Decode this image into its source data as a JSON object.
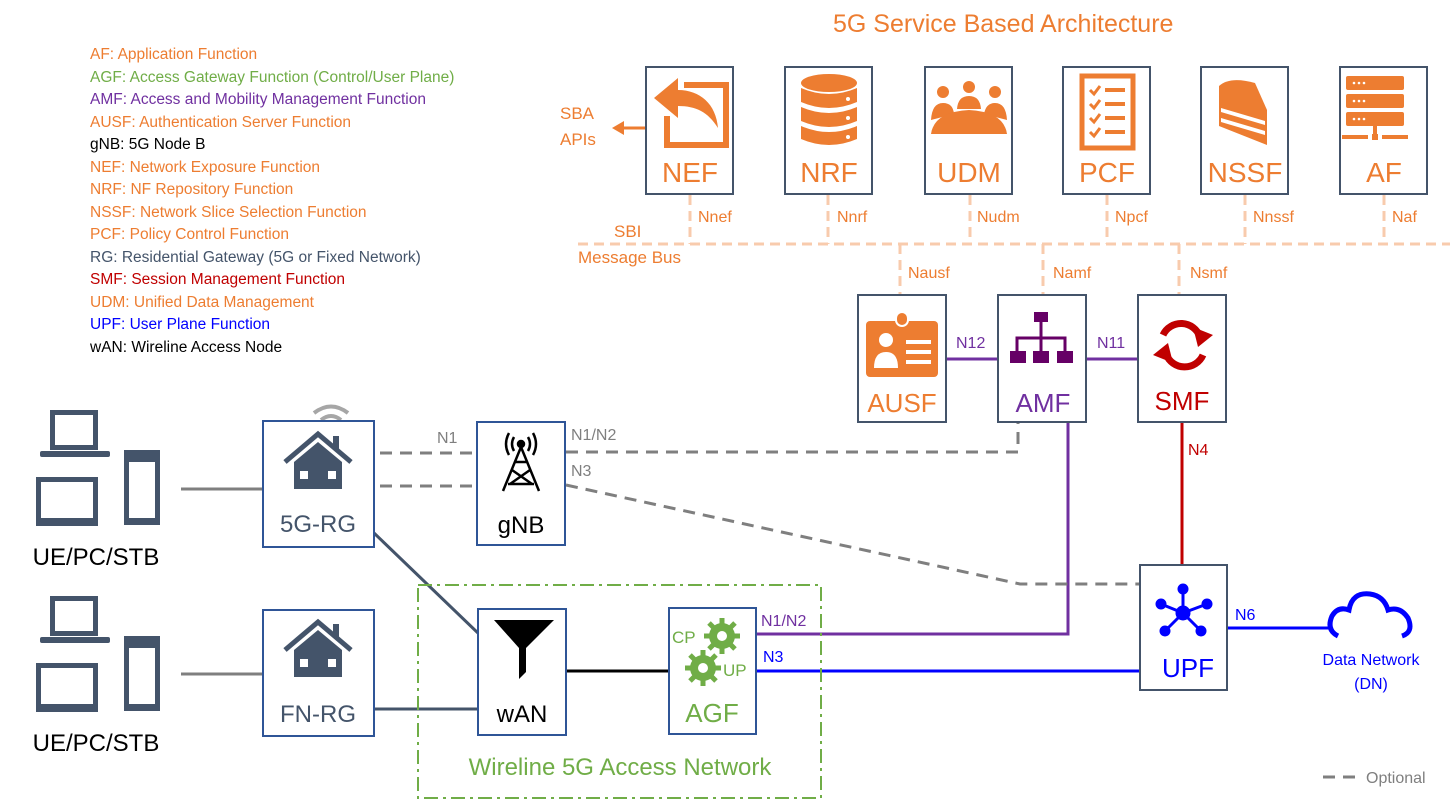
{
  "title": "5G Service Based Architecture",
  "colors": {
    "orange": "#ED7D31",
    "light_orange": "#F8CBAD",
    "green": "#70AD47",
    "purple": "#7030A0",
    "amf_purple": "#660066",
    "red": "#C00000",
    "blue": "#0000FF",
    "slate": "#44546A",
    "box_border": "#2F4F7F",
    "gray": "#7F7F7F",
    "black": "#000000"
  },
  "legend": [
    {
      "text": "AF: Application Function",
      "color": "#ED7D31"
    },
    {
      "text": "AGF: Access Gateway Function (Control/User Plane)",
      "color": "#70AD47"
    },
    {
      "text": "AMF: Access and Mobility Management Function",
      "color": "#7030A0"
    },
    {
      "text": "AUSF: Authentication Server Function",
      "color": "#ED7D31"
    },
    {
      "text": "gNB: 5G Node B",
      "color": "#000000"
    },
    {
      "text": "NEF: Network Exposure Function",
      "color": "#ED7D31"
    },
    {
      "text": "NRF: NF Repository Function",
      "color": "#ED7D31"
    },
    {
      "text": "NSSF: Network Slice Selection Function",
      "color": "#ED7D31"
    },
    {
      "text": "PCF: Policy Control Function",
      "color": "#ED7D31"
    },
    {
      "text": "RG: Residential Gateway (5G or Fixed Network)",
      "color": "#44546A"
    },
    {
      "text": "SMF: Session Management Function",
      "color": "#C00000"
    },
    {
      "text": "UDM: Unified Data Management",
      "color": "#ED7D31"
    },
    {
      "text": "UPF: User Plane Function",
      "color": "#0000FF"
    },
    {
      "text": "wAN: Wireline Access Node",
      "color": "#000000"
    }
  ],
  "sba": {
    "nfs": [
      {
        "name": "NEF",
        "interface": "Nnef",
        "icon": "share-arrow-icon"
      },
      {
        "name": "NRF",
        "interface": "Nnrf",
        "icon": "database-icon"
      },
      {
        "name": "UDM",
        "interface": "Nudm",
        "icon": "group-meeting-icon"
      },
      {
        "name": "PCF",
        "interface": "Npcf",
        "icon": "checklist-icon"
      },
      {
        "name": "NSSF",
        "interface": "Nnssf",
        "icon": "cake-slice-icon"
      },
      {
        "name": "AF",
        "interface": "Naf",
        "icon": "server-rack-icon"
      }
    ],
    "sba_apis_line1": "SBA",
    "sba_apis_line2": "APIs",
    "bus_label_top": "SBI",
    "bus_label_bottom": "Message Bus"
  },
  "core": {
    "ausf": {
      "name": "AUSF",
      "interface": "Nausf"
    },
    "amf": {
      "name": "AMF",
      "interface": "Namf"
    },
    "smf": {
      "name": "SMF",
      "interface": "Nsmf"
    },
    "upf": {
      "name": "UPF"
    },
    "n12": "N12",
    "n11": "N11",
    "n4": "N4",
    "n6": "N6"
  },
  "access": {
    "ue_label": "UE/PC/STB",
    "rg5g": "5G-RG",
    "fnrg": "FN-RG",
    "gnb": "gNB",
    "wan": "wAN",
    "agf": "AGF",
    "agf_cp": "CP",
    "agf_up": "UP",
    "n1": "N1",
    "gnb_n1n2": "N1/N2",
    "gnb_n3": "N3",
    "agf_n1n2": "N1/N2",
    "agf_n3": "N3",
    "wireline_label": "Wireline 5G Access Network"
  },
  "dn": {
    "line1": "Data Network",
    "line2": "(DN)"
  },
  "key": {
    "optional": "Optional"
  }
}
